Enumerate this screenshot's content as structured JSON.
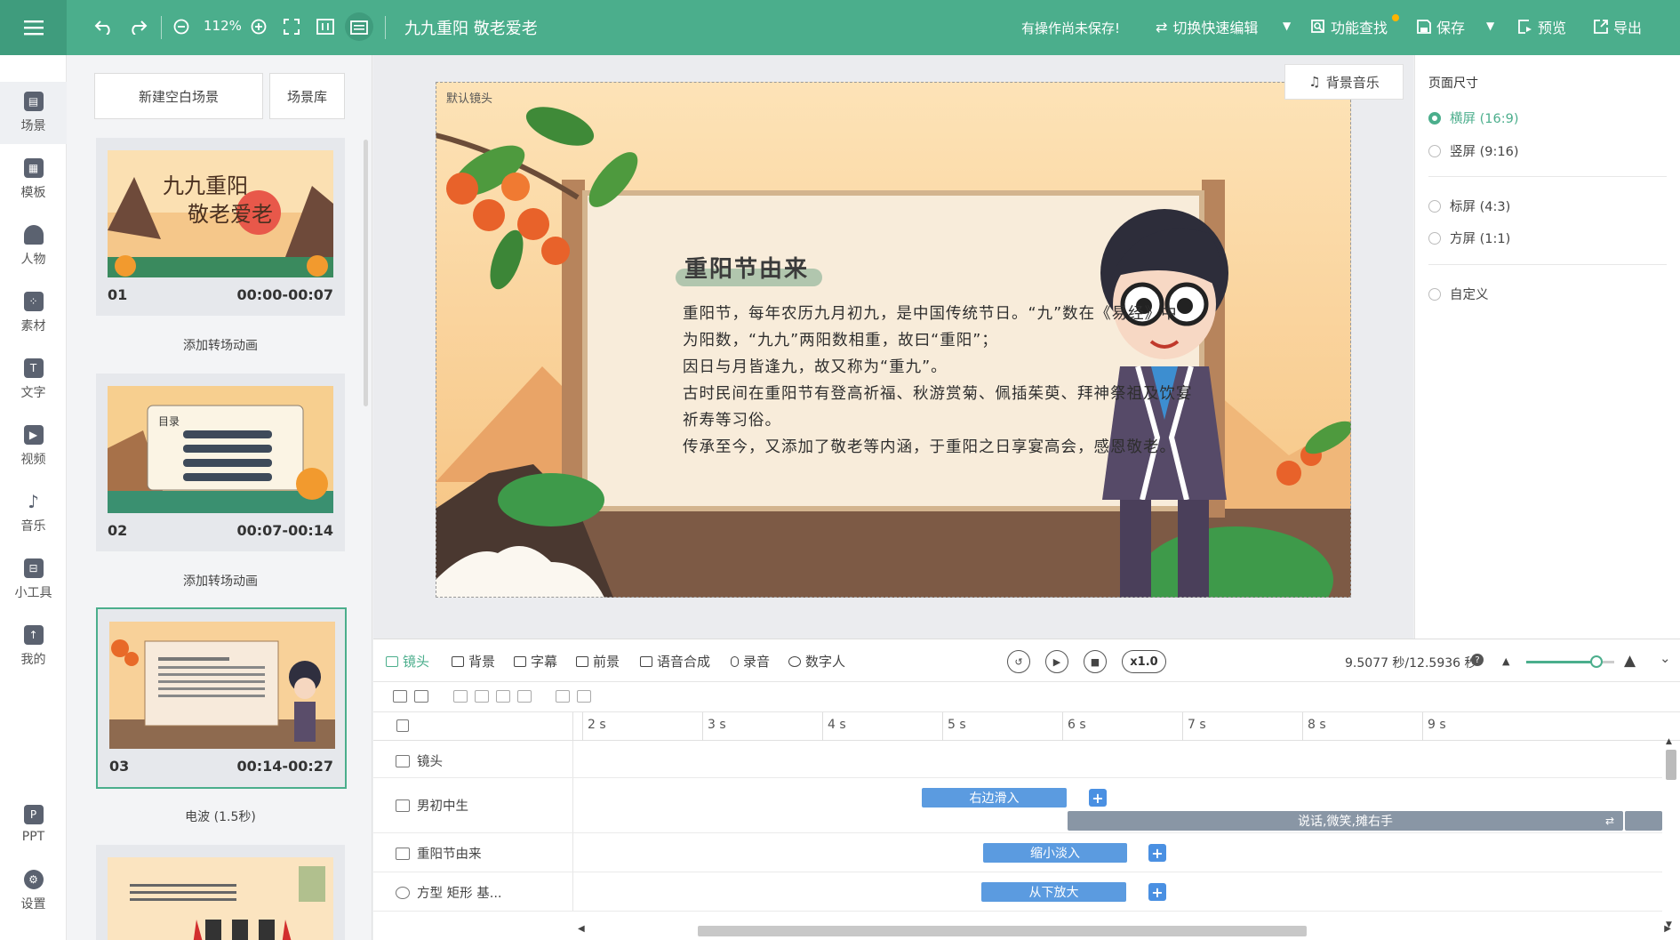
{
  "app": {
    "doc_title": "九九重阳 敬老爱老",
    "unsaved_notice": "有操作尚未保存!",
    "zoom": "112%"
  },
  "toolbar": {
    "switch_edit": "切换快速编辑",
    "find": "功能查找",
    "save": "保存",
    "preview": "预览",
    "export": "导出"
  },
  "leftnav": [
    {
      "label": "场景",
      "icon": "scene-icon"
    },
    {
      "label": "模板",
      "icon": "template-icon"
    },
    {
      "label": "人物",
      "icon": "person-icon"
    },
    {
      "label": "素材",
      "icon": "material-icon"
    },
    {
      "label": "文字",
      "icon": "text-icon"
    },
    {
      "label": "视频",
      "icon": "video-icon"
    },
    {
      "label": "音乐",
      "icon": "music-icon"
    },
    {
      "label": "小工具",
      "icon": "toolbox-icon"
    },
    {
      "label": "我的",
      "icon": "upload-icon"
    },
    {
      "label": "PPT",
      "icon": "ppt-icon"
    },
    {
      "label": "设置",
      "icon": "gear-icon"
    }
  ],
  "scenes_panel": {
    "new_scene": "新建空白场景",
    "scene_library": "场景库",
    "scenes": [
      {
        "num": "01",
        "time": "00:00-00:07",
        "thumb_title": "九九重阳 敬老爱老",
        "after": "添加转场动画"
      },
      {
        "num": "02",
        "time": "00:07-00:14",
        "thumb_title": "目录",
        "after": "添加转场动画"
      },
      {
        "num": "03",
        "time": "00:14-00:27",
        "thumb_title": "重阳节由来",
        "after": "电波 (1.5秒)"
      },
      {
        "num": "04",
        "time": "",
        "thumb_title": "",
        "after": ""
      }
    ]
  },
  "stage": {
    "bgm_button": "背景音乐",
    "lens_label": "默认镜头",
    "slide_title": "重阳节由来",
    "paragraphs": [
      "重阳节，每年农历九月初九，是中国传统节日。“九”数在《易经》中",
      "为阳数，“九九”两阳数相重，故曰“重阳”；",
      "因日与月皆逢九，故又称为“重九”。",
      "古时民间在重阳节有登高祈福、秋游赏菊、佩插茱萸、拜神祭祖及饮宴",
      "祈寿等习俗。",
      "传承至今，又添加了敬老等内涵，于重阳之日享宴高会，感恩敬老。"
    ]
  },
  "page_size": {
    "title": "页面尺寸",
    "options": [
      {
        "label": "横屏  (16:9)",
        "selected": true
      },
      {
        "label": "竖屏  (9:16)",
        "selected": false
      },
      {
        "label": "标屏  (4:3)",
        "selected": false
      },
      {
        "label": "方屏  (1:1)",
        "selected": false
      },
      {
        "label": "自定义",
        "selected": false
      }
    ]
  },
  "timeline": {
    "tabs": [
      "镜头",
      "背景",
      "字幕",
      "前景",
      "语音合成",
      "录音",
      "数字人"
    ],
    "speed": "x1.0",
    "time_readout": "9.5077 秒/12.5936 秒",
    "zoom_level": 0.8,
    "ticks": [
      "2 s",
      "3 s",
      "4 s",
      "5 s",
      "6 s",
      "7 s",
      "8 s",
      "9 s"
    ],
    "tracks": [
      {
        "label": "镜头",
        "icon": "camera-icon"
      },
      {
        "label": "男初中生",
        "icon": "image-icon",
        "clips": [
          {
            "label": "右边滑入"
          },
          {
            "label": "说话,微笑,摊右手"
          }
        ]
      },
      {
        "label": "重阳节由来",
        "icon": "text-box-icon",
        "clips": [
          {
            "label": "缩小淡入"
          }
        ]
      },
      {
        "label": "方型 矩形 基...",
        "icon": "shape-icon",
        "clips": [
          {
            "label": "从下放大"
          }
        ]
      }
    ]
  },
  "colors": {
    "accent": "#4bae8c",
    "clip_blue": "#5b9be0",
    "clip_gray": "#8996a5"
  }
}
